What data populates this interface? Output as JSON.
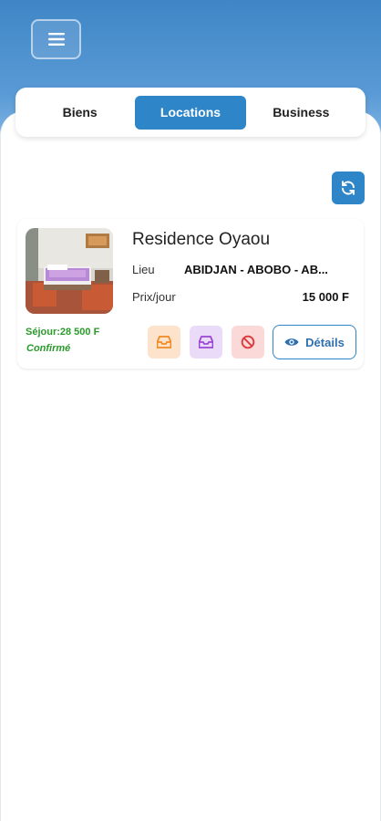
{
  "colors": {
    "primary": "#2e86c9",
    "header_gradient_top": "#3f86c6",
    "success_text": "#2a9a2a",
    "action_orange_bg": "#fde3cc",
    "action_purple_bg": "#eadcf8",
    "action_red_bg": "#fbd9d9"
  },
  "header": {
    "menu_icon": "hamburger-icon"
  },
  "tabs": [
    {
      "label": "Biens",
      "active": false
    },
    {
      "label": "Locations",
      "active": true
    },
    {
      "label": "Business",
      "active": false
    }
  ],
  "toolbar": {
    "refresh_icon": "refresh-icon"
  },
  "rentals": [
    {
      "name": "Residence Oyaou",
      "lieu_label": "Lieu",
      "lieu_value": "ABIDJAN - ABOBO - AB...",
      "prix_label": "Prix/jour",
      "prix_value": "15 000 F",
      "sejour": "Séjour:28 500 F",
      "statut": "Confirmé",
      "image_icon": "bedroom-photo",
      "actions": [
        {
          "icon": "inbox-tray-icon",
          "color": "orange"
        },
        {
          "icon": "inbox-tray-icon",
          "color": "purple"
        },
        {
          "icon": "cancel-icon",
          "color": "red"
        }
      ],
      "details_label": "Détails",
      "details_icon": "eye-icon"
    }
  ]
}
